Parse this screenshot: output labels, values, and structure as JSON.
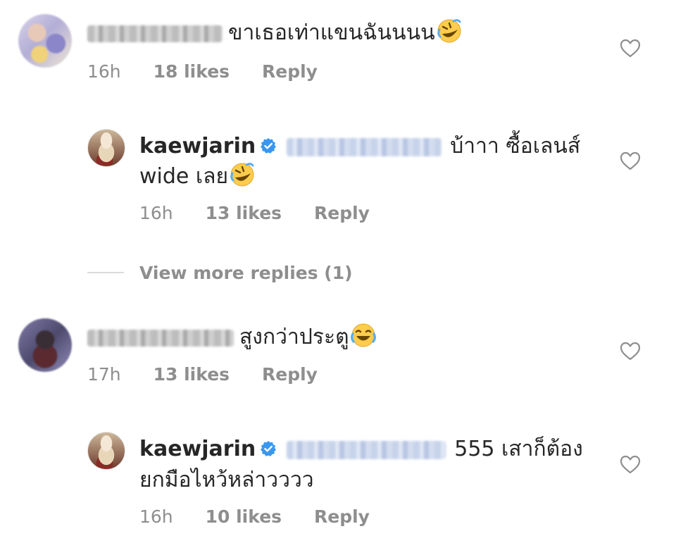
{
  "comments": [
    {
      "text": "ขาเธอเท่าแขนฉันนนน",
      "emoji": "rolling-on-floor-laughing-emoji",
      "time": "16h",
      "likes": "18 likes",
      "reply": "Reply"
    },
    {
      "username": "kaewjarin",
      "text_line1": "บ้าาา ซื้อเลนส์",
      "text_line2": "wide เลย",
      "emoji": "rolling-on-floor-laughing-emoji",
      "time": "16h",
      "likes": "13 likes",
      "reply": "Reply"
    },
    {
      "text": "สูงกว่าประตู",
      "emoji": "face-with-tears-of-joy-emoji",
      "time": "17h",
      "likes": "13 likes",
      "reply": "Reply"
    },
    {
      "username": "kaewjarin",
      "text_line1": "555 เสาก็ต้อง",
      "text_line2": "ยกมือไหว้หล่าวววว",
      "time": "16h",
      "likes": "10 likes",
      "reply": "Reply"
    }
  ],
  "view_more": "View more replies (1)",
  "colors": {
    "text": "#262626",
    "secondary": "#8e8e8e",
    "verified": "#3897f0",
    "divider": "#dbdbdb"
  }
}
